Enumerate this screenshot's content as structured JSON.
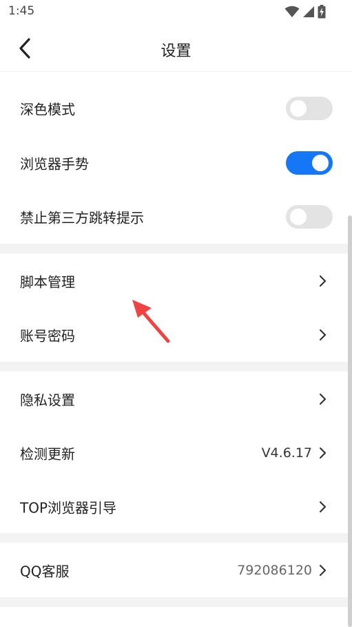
{
  "status_bar": {
    "time": "1:45",
    "icons": [
      "wifi-icon",
      "signal-icon",
      "battery-charging-icon"
    ]
  },
  "header": {
    "title": "设置",
    "back_icon": "chevron-left-icon"
  },
  "sections": {
    "toggles": [
      {
        "label": "深色模式",
        "enabled": false
      },
      {
        "label": "浏览器手势",
        "enabled": true
      },
      {
        "label": "禁止第三方跳转提示",
        "enabled": false
      }
    ],
    "tools": [
      {
        "label": "脚本管理"
      },
      {
        "label": "账号密码"
      }
    ],
    "app": [
      {
        "label": "隐私设置",
        "value": ""
      },
      {
        "label": "检测更新",
        "value": "V4.6.17"
      },
      {
        "label": "TOP浏览器引导",
        "value": ""
      }
    ],
    "support": [
      {
        "label": "QQ客服",
        "value": "792086120"
      }
    ]
  },
  "colors": {
    "accent": "#1677f6",
    "toggle_off": "#e3e3e3",
    "separator": "#f3f3f3",
    "annotation_arrow": "#f04444"
  }
}
